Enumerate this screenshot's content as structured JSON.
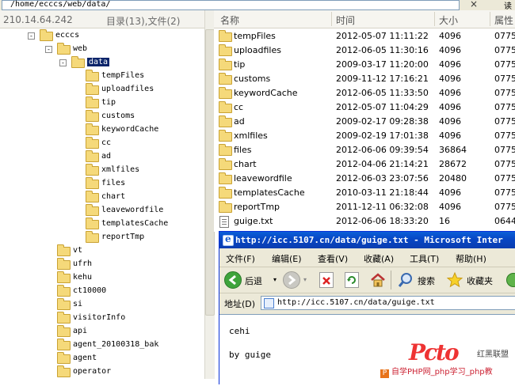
{
  "path_bar": {
    "path": "/home/ecccs/web/data/",
    "close": "×",
    "side_text": "读"
  },
  "left_panel": {
    "ip": "210.14.64.242",
    "dir_count": "目录(13),文件(2)",
    "tree": [
      {
        "label": "ecccs",
        "level": 0,
        "pm": "-"
      },
      {
        "label": "web",
        "level": 1,
        "pm": "-"
      },
      {
        "label": "data",
        "level": 2,
        "pm": "-",
        "selected": true
      },
      {
        "label": "tempFiles",
        "level": 3
      },
      {
        "label": "uploadfiles",
        "level": 3
      },
      {
        "label": "tip",
        "level": 3
      },
      {
        "label": "customs",
        "level": 3
      },
      {
        "label": "keywordCache",
        "level": 3
      },
      {
        "label": "cc",
        "level": 3
      },
      {
        "label": "ad",
        "level": 3
      },
      {
        "label": "xmlfiles",
        "level": 3
      },
      {
        "label": "files",
        "level": 3
      },
      {
        "label": "chart",
        "level": 3
      },
      {
        "label": "leavewordfile",
        "level": 3
      },
      {
        "label": "templatesCache",
        "level": 3
      },
      {
        "label": "reportTmp",
        "level": 3
      },
      {
        "label": "vt",
        "level": 1
      },
      {
        "label": "ufrh",
        "level": 1
      },
      {
        "label": "kehu",
        "level": 1
      },
      {
        "label": "ct10000",
        "level": 1
      },
      {
        "label": "si",
        "level": 1
      },
      {
        "label": "visitorInfo",
        "level": 1
      },
      {
        "label": "api",
        "level": 1
      },
      {
        "label": "agent_20100318_bak",
        "level": 1
      },
      {
        "label": "agent",
        "level": 1
      },
      {
        "label": "operator",
        "level": 1
      }
    ]
  },
  "file_list": {
    "columns": {
      "name": "名称",
      "time": "时间",
      "size": "大小",
      "perm": "属性"
    },
    "rows": [
      {
        "name": "tempFiles",
        "time": "2012-05-07 11:11:22",
        "size": "4096",
        "perm": "0775",
        "type": "folder"
      },
      {
        "name": "uploadfiles",
        "time": "2012-06-05 11:30:16",
        "size": "4096",
        "perm": "0775",
        "type": "folder"
      },
      {
        "name": "tip",
        "time": "2009-03-17 11:20:00",
        "size": "4096",
        "perm": "0775",
        "type": "folder"
      },
      {
        "name": "customs",
        "time": "2009-11-12 17:16:21",
        "size": "4096",
        "perm": "0775",
        "type": "folder"
      },
      {
        "name": "keywordCache",
        "time": "2012-06-05 11:33:50",
        "size": "4096",
        "perm": "0775",
        "type": "folder"
      },
      {
        "name": "cc",
        "time": "2012-05-07 11:04:29",
        "size": "4096",
        "perm": "0775",
        "type": "folder"
      },
      {
        "name": "ad",
        "time": "2009-02-17 09:28:38",
        "size": "4096",
        "perm": "0775",
        "type": "folder"
      },
      {
        "name": "xmlfiles",
        "time": "2009-02-19 17:01:38",
        "size": "4096",
        "perm": "0775",
        "type": "folder"
      },
      {
        "name": "files",
        "time": "2012-06-06 09:39:54",
        "size": "36864",
        "perm": "0775",
        "type": "folder"
      },
      {
        "name": "chart",
        "time": "2012-04-06 21:14:21",
        "size": "28672",
        "perm": "0775",
        "type": "folder"
      },
      {
        "name": "leavewordfile",
        "time": "2012-06-03 23:07:56",
        "size": "20480",
        "perm": "0775",
        "type": "folder"
      },
      {
        "name": "templatesCache",
        "time": "2010-03-11 21:18:44",
        "size": "4096",
        "perm": "0775",
        "type": "folder"
      },
      {
        "name": "reportTmp",
        "time": "2011-12-11 06:32:08",
        "size": "4096",
        "perm": "0775",
        "type": "folder"
      },
      {
        "name": "guige.txt",
        "time": "2012-06-06 18:33:20",
        "size": "16",
        "perm": "0644",
        "type": "file"
      }
    ]
  },
  "ie_window": {
    "title": "http://icc.5107.cn/data/guige.txt - Microsoft Inter",
    "menu": [
      {
        "label": "文件(F)",
        "name": "menu-file"
      },
      {
        "label": "编辑(E)",
        "name": "menu-edit"
      },
      {
        "label": "查看(V)",
        "name": "menu-view"
      },
      {
        "label": "收藏(A)",
        "name": "menu-favorites"
      },
      {
        "label": "工具(T)",
        "name": "menu-tools"
      },
      {
        "label": "帮助(H)",
        "name": "menu-help"
      }
    ],
    "toolbar": {
      "back": "后退",
      "search": "搜索",
      "favorites": "收藏夹"
    },
    "address_label": "地址(D)",
    "address": "http://icc.5107.cn/data/guige.txt",
    "content": {
      "line1": "cehi",
      "line2": "by guige"
    }
  },
  "watermark": {
    "logo": "Pcto",
    "tagline": "红黑联盟",
    "text": "自学PHP网_php学习_php教"
  }
}
